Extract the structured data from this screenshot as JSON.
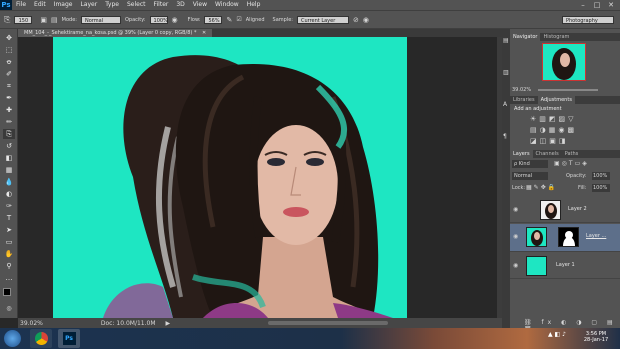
{
  "menubar": {
    "logo": "Ps",
    "items": [
      "File",
      "Edit",
      "Image",
      "Layer",
      "Type",
      "Select",
      "Filter",
      "3D",
      "View",
      "Window",
      "Help"
    ],
    "min": "–",
    "max": "□",
    "close": "✕"
  },
  "options": {
    "brush_size": "150",
    "mode_label": "Mode:",
    "mode_value": "Normal",
    "opacity_label": "Opacity:",
    "opacity_value": "100%",
    "flow_label": "Flow:",
    "flow_value": "56%",
    "aligned_label": "Aligned",
    "sample_label": "Sample:",
    "sample_value": "Current Layer",
    "workspace": "Photography"
  },
  "document": {
    "tab_title": "MM_104_-_Sehektirame_na_kosa.psd @ 39% (Layer 0 copy, RGB/8) *",
    "tab_close": "✕",
    "zoom": "39.02%",
    "doc_info": "Doc: 10.0M/11.0M"
  },
  "navigator": {
    "tabs": [
      "Navigator",
      "Histogram"
    ],
    "zoom": "39.02%"
  },
  "adjustments": {
    "tabs": [
      "Libraries",
      "Adjustments"
    ],
    "heading": "Add an adjustment"
  },
  "layers_panel": {
    "tabs": [
      "Layers",
      "Channels",
      "Paths"
    ],
    "kind_label": "ρ Kind",
    "blend_mode": "Normal",
    "opacity_label": "Opacity:",
    "opacity_value": "100%",
    "lock_label": "Lock:",
    "fill_label": "Fill:",
    "fill_value": "100%",
    "layers": [
      {
        "name": "Layer 2"
      },
      {
        "name": "Layer ..."
      },
      {
        "name": "Layer 1"
      }
    ],
    "canvas_color": "#1ee6c2"
  },
  "taskbar": {
    "time": "3:56 PM",
    "date": "28-Jan-17",
    "ps_label": "Ps"
  }
}
